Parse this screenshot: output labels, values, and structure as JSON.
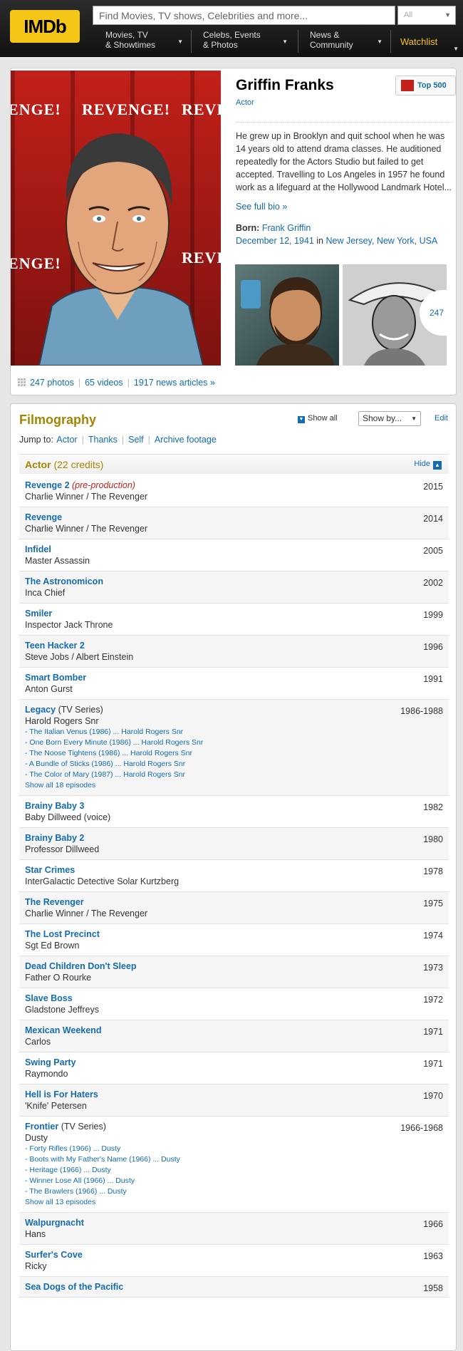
{
  "header": {
    "logo": "IMDb",
    "search_placeholder": "Find Movies, TV shows, Celebrities and more...",
    "search_filter": "All",
    "nav": [
      {
        "line1": "Movies, TV",
        "line2": "& Showtimes"
      },
      {
        "line1": "Celebs, Events",
        "line2": "& Photos"
      },
      {
        "line1": "News &",
        "line2": "Community"
      }
    ],
    "watchlist": "Watchlist"
  },
  "profile": {
    "name": "Griffin Franks",
    "role": "Actor",
    "top_badge": "Top 500",
    "bio": "He grew up in Brooklyn and quit school when he was 14 years old to attend drama classes. He auditioned repeatedly for the Actors Studio but failed to get accepted. Travelling to Los Angeles in 1957 he found work as a lifeguard at the Hollywood Landmark Hotel...",
    "full_bio": "See full bio »",
    "born_label": "Born:",
    "born_name": "Frank Griffin",
    "born_date": "December 12, 1941",
    "born_in": "in",
    "born_place": "New Jersey, New York, USA",
    "poster_words": [
      "ENGE!",
      "REVENGE!",
      "REVEN",
      "ENGE!",
      "REVEN"
    ],
    "photo_count": "247",
    "media": {
      "photos": "247 photos",
      "videos": "65 videos",
      "news": "1917 news articles »"
    }
  },
  "filmography": {
    "title": "Filmography",
    "show_all": "Show all",
    "show_by": "Show by...",
    "edit": "Edit",
    "jump_label": "Jump to:",
    "jump_links": [
      "Actor",
      "Thanks",
      "Self",
      "Archive footage"
    ],
    "section_name": "Actor",
    "section_credits": "(22 credits)",
    "hide": "Hide",
    "credits": [
      {
        "title": "Revenge 2",
        "status": "(pre-production)",
        "year": "2015",
        "role": "Charlie Winner / The Revenger"
      },
      {
        "title": "Revenge",
        "year": "2014",
        "role": "Charlie Winner / The Revenger"
      },
      {
        "title": "Infidel",
        "year": "2005",
        "role": "Master Assassin"
      },
      {
        "title": "The Astronomicon",
        "year": "2002",
        "role": "Inca Chief"
      },
      {
        "title": "Smiler",
        "year": "1999",
        "role": "Inspector Jack Throne"
      },
      {
        "title": "Teen Hacker 2",
        "year": "1996",
        "role": "Steve Jobs / Albert Einstein"
      },
      {
        "title": "Smart Bomber",
        "year": "1991",
        "role": "Anton Gurst"
      },
      {
        "title": "Legacy",
        "kind": "(TV Series)",
        "year": "1986-1988",
        "role": "Harold Rogers Snr",
        "episodes": [
          "- The Italian Venus (1986) ... Harold Rogers Snr",
          "- One Born Every Minute (1986) ... Harold Rogers Snr",
          "- The Noose Tightens (1986) ... Harold Rogers Snr",
          "- A Bundle of Sticks (1986) ... Harold Rogers Snr",
          "- The Color of Mary (1987) ... Harold Rogers Snr"
        ],
        "show_episodes": "Show all 18 episodes"
      },
      {
        "title": "Brainy Baby 3",
        "year": "1982",
        "role": "Baby Dillweed (voice)"
      },
      {
        "title": "Brainy Baby 2",
        "year": "1980",
        "role": "Professor Dillweed"
      },
      {
        "title": "Star Crimes",
        "year": "1978",
        "role": "InterGalactic Detective Solar Kurtzberg"
      },
      {
        "title": "The Revenger",
        "year": "1975",
        "role": "Charlie Winner / The Revenger"
      },
      {
        "title": "The Lost Precinct",
        "year": "1974",
        "role": "Sgt Ed Brown"
      },
      {
        "title": "Dead Children Don't Sleep",
        "year": "1973",
        "role": "Father O Rourke"
      },
      {
        "title": "Slave Boss",
        "year": "1972",
        "role": "Gladstone Jeffreys"
      },
      {
        "title": "Mexican Weekend",
        "year": "1971",
        "role": "Carlos"
      },
      {
        "title": "Swing Party",
        "year": "1971",
        "role": "Raymondo"
      },
      {
        "title": "Hell is For Haters",
        "year": "1970",
        "role": "'Knife' Petersen"
      },
      {
        "title": "Frontier",
        "kind": "(TV Series)",
        "year": "1966-1968",
        "role": "Dusty",
        "episodes": [
          "- Forty Rifles (1966) ... Dusty",
          "- Boots with My Father's Name (1966) ... Dusty",
          "- Heritage (1966) ... Dusty",
          "- Winner Lose All (1966) ... Dusty",
          "- The Brawlers (1966) ... Dusty"
        ],
        "show_episodes": "Show all 13 episodes"
      },
      {
        "title": "Walpurgnacht",
        "year": "1966",
        "role": "Hans"
      },
      {
        "title": "Surfer's Cove",
        "year": "1963",
        "role": "Ricky"
      },
      {
        "title": "Sea Dogs of the Pacific",
        "year": "1958",
        "role": ""
      }
    ]
  },
  "colors": {
    "accent": "#f5c518",
    "link": "#136cb2",
    "section_gold": "#a58500",
    "badge_red": "#c3201a"
  }
}
